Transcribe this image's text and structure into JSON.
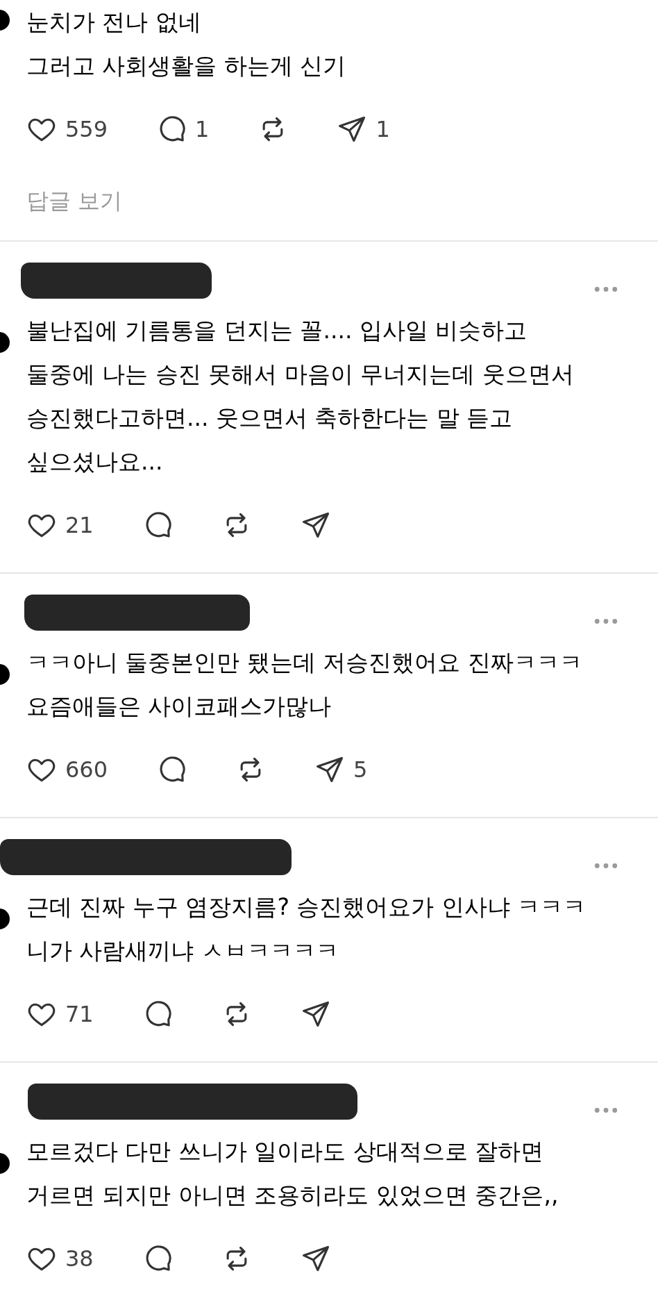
{
  "top_post": {
    "lines": [
      "눈치가 전나 없네",
      "그러고 사회생활을 하는게 신기"
    ],
    "actions": [
      {
        "kind": "like",
        "count": "559"
      },
      {
        "kind": "comment",
        "count": "1"
      },
      {
        "kind": "repost"
      },
      {
        "kind": "share",
        "count": "1"
      }
    ],
    "view_replies": "답글 보기"
  },
  "comments": [
    {
      "lines": [
        "불난집에 기름통을 던지는 꼴.... 입사일 비슷하고",
        "둘중에 나는 승진 못해서 마음이 무너지는데 웃으면서",
        "승진했다고하면... 웃으면서 축하한다는 말 듣고",
        "싶으셨나요..."
      ],
      "actions": [
        {
          "kind": "like",
          "count": "21"
        },
        {
          "kind": "comment"
        },
        {
          "kind": "repost"
        },
        {
          "kind": "share"
        }
      ]
    },
    {
      "lines": [
        "ㅋㅋ아니 둘중본인만 됐는데 저승진했어요 진짜ㅋㅋㅋ",
        "요즘애들은 사이코패스가많나"
      ],
      "actions": [
        {
          "kind": "like",
          "count": "660"
        },
        {
          "kind": "comment"
        },
        {
          "kind": "repost"
        },
        {
          "kind": "share",
          "count": "5"
        }
      ]
    },
    {
      "lines": [
        "근데 진짜 누구 염장지름? 승진했어요가 인사냐 ㅋㅋㅋ",
        "니가 사람새끼냐 ㅅㅂㅋㅋㅋㅋ"
      ],
      "actions": [
        {
          "kind": "like",
          "count": "71"
        },
        {
          "kind": "comment"
        },
        {
          "kind": "repost"
        },
        {
          "kind": "share"
        }
      ]
    },
    {
      "lines": [
        "모르겄다 다만 쓰니가 일이라도 상대적으로 잘하면",
        "거르면 되지만 아니면 조용히라도 있었으면 중간은,,"
      ],
      "actions": [
        {
          "kind": "like",
          "count": "38"
        },
        {
          "kind": "comment"
        },
        {
          "kind": "repost"
        },
        {
          "kind": "share"
        }
      ]
    }
  ]
}
